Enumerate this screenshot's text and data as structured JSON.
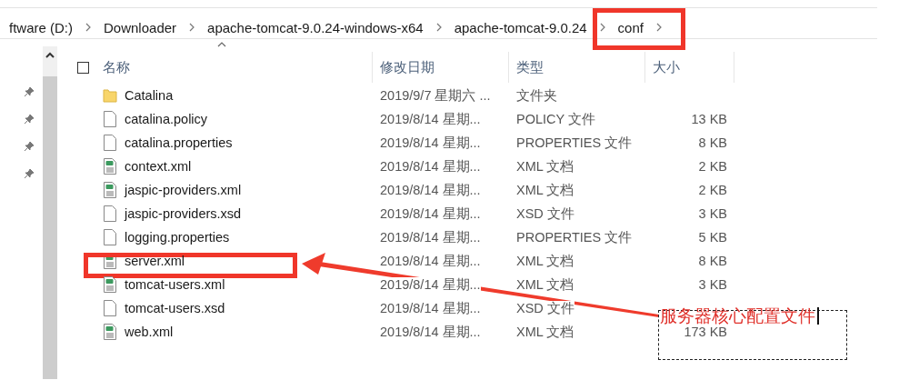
{
  "address_bar": {
    "crumbs": [
      {
        "label": "ftware (D:)",
        "highlighted": false
      },
      {
        "label": "Downloader",
        "highlighted": false
      },
      {
        "label": "apache-tomcat-9.0.24-windows-x64",
        "highlighted": false
      },
      {
        "label": "apache-tomcat-9.0.24",
        "highlighted": false
      },
      {
        "label": "conf",
        "highlighted": true
      }
    ]
  },
  "select_all": {
    "checked": false
  },
  "columns": [
    "名称",
    "修改日期",
    "类型",
    "大小"
  ],
  "rows": [
    {
      "kind": "folder",
      "name": "Catalina",
      "date": "2019/9/7 星期六 ...",
      "type": "文件夹",
      "highlighted": false
    },
    {
      "kind": "file",
      "name": "catalina.policy",
      "date": "2019/8/14 星期...",
      "type": "POLICY 文件",
      "size": "13 KB",
      "highlighted": false
    },
    {
      "kind": "file",
      "name": "catalina.properties",
      "date": "2019/8/14 星期...",
      "type": "PROPERTIES 文件",
      "size": "8 KB",
      "highlighted": false
    },
    {
      "kind": "xml",
      "name": "context.xml",
      "date": "2019/8/14 星期...",
      "type": "XML 文档",
      "size": "2 KB",
      "highlighted": false
    },
    {
      "kind": "xml",
      "name": "jaspic-providers.xml",
      "date": "2019/8/14 星期...",
      "type": "XML 文档",
      "size": "2 KB",
      "highlighted": false
    },
    {
      "kind": "file",
      "name": "jaspic-providers.xsd",
      "date": "2019/8/14 星期...",
      "type": "XSD 文件",
      "size": "3 KB",
      "highlighted": false
    },
    {
      "kind": "file",
      "name": "logging.properties",
      "date": "2019/8/14 星期...",
      "type": "PROPERTIES 文件",
      "size": "5 KB",
      "highlighted": false
    },
    {
      "kind": "xml",
      "name": "server.xml",
      "date": "2019/8/14 星期...",
      "type": "XML 文档",
      "size": "8 KB",
      "highlighted": true
    },
    {
      "kind": "xml",
      "name": "tomcat-users.xml",
      "date": "2019/8/14 星期...",
      "type": "XML 文档",
      "size": "3 KB",
      "highlighted": false
    },
    {
      "kind": "file",
      "name": "tomcat-users.xsd",
      "date": "2019/8/14 星期...",
      "type": "XSD 文件",
      "highlighted": false
    },
    {
      "kind": "xml",
      "name": "web.xml",
      "date": "2019/8/14 星期...",
      "type": "XML 文档",
      "size": "173 KB",
      "highlighted": false
    }
  ],
  "callout": {
    "text": "服务器核心配置文件"
  }
}
